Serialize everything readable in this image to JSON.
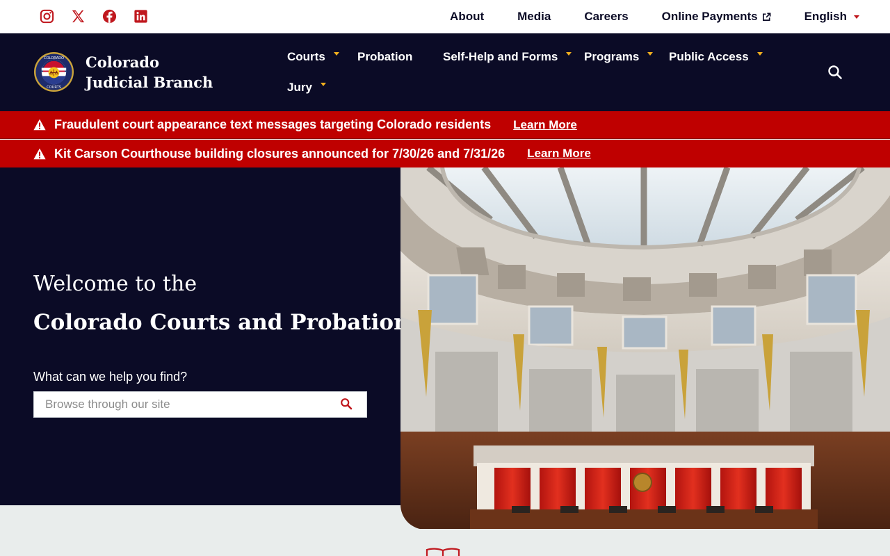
{
  "utility": {
    "social": [
      {
        "name": "instagram-icon",
        "label": "Instagram"
      },
      {
        "name": "x-icon",
        "label": "X"
      },
      {
        "name": "facebook-icon",
        "label": "Facebook"
      },
      {
        "name": "linkedin-icon",
        "label": "LinkedIn"
      }
    ],
    "links": {
      "about": "About",
      "media": "Media",
      "careers": "Careers",
      "online_payments": "Online Payments",
      "language": "English"
    }
  },
  "brand": {
    "name": "Colorado Judicial Branch",
    "seal_top_text": "COLORADO",
    "seal_bottom_text": "COURTS"
  },
  "nav": {
    "courts": "Courts",
    "probation": "Probation",
    "self_help": "Self-Help and Forms",
    "programs": "Programs",
    "public_access": "Public Access",
    "jury": "Jury"
  },
  "alerts": [
    {
      "message": "Fraudulent court appearance text messages targeting Colorado residents",
      "link": "Learn More"
    },
    {
      "message": "Kit Carson Courthouse building closures announced for 7/30/26 and 7/31/26",
      "link": "Learn More"
    }
  ],
  "hero": {
    "welcome": "Welcome to the",
    "title": "Colorado Courts and Probation",
    "help_label": "What can we help you find?",
    "search_placeholder": "Browse through our site"
  },
  "colors": {
    "navy": "#0b0b26",
    "alert_red": "#bf0000",
    "accent_gold": "#f2b01e",
    "icon_red": "#c0181e",
    "page_bg": "#e9edec"
  }
}
